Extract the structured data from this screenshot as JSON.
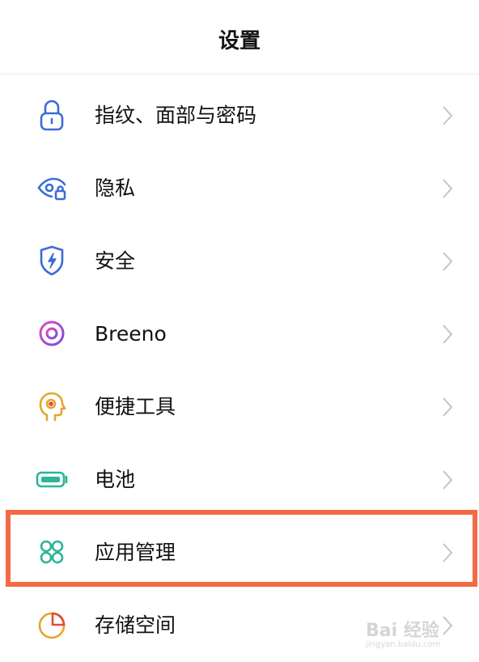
{
  "header": {
    "title": "设置"
  },
  "items": [
    {
      "label": "指纹、面部与密码",
      "icon": "lock-icon",
      "color": "#3d6bd6"
    },
    {
      "label": "隐私",
      "icon": "privacy-eye-icon",
      "color": "#3d6bd6"
    },
    {
      "label": "安全",
      "icon": "shield-icon",
      "color": "#3d6bd6"
    },
    {
      "label": "Breeno",
      "icon": "breeno-ring-icon",
      "color": "#b04ad6"
    },
    {
      "label": "便捷工具",
      "icon": "head-tool-icon",
      "color": "#e5a52e"
    },
    {
      "label": "电池",
      "icon": "battery-icon",
      "color": "#2bb59a"
    },
    {
      "label": "应用管理",
      "icon": "apps-grid-icon",
      "color": "#2bb59a",
      "highlighted": true
    },
    {
      "label": "存储空间",
      "icon": "storage-pie-icon",
      "color": "#e8742e"
    }
  ],
  "highlight_color": "#f26b43",
  "watermark": {
    "text": "Bai 经验",
    "sub": "jingyan.baidu.com"
  }
}
